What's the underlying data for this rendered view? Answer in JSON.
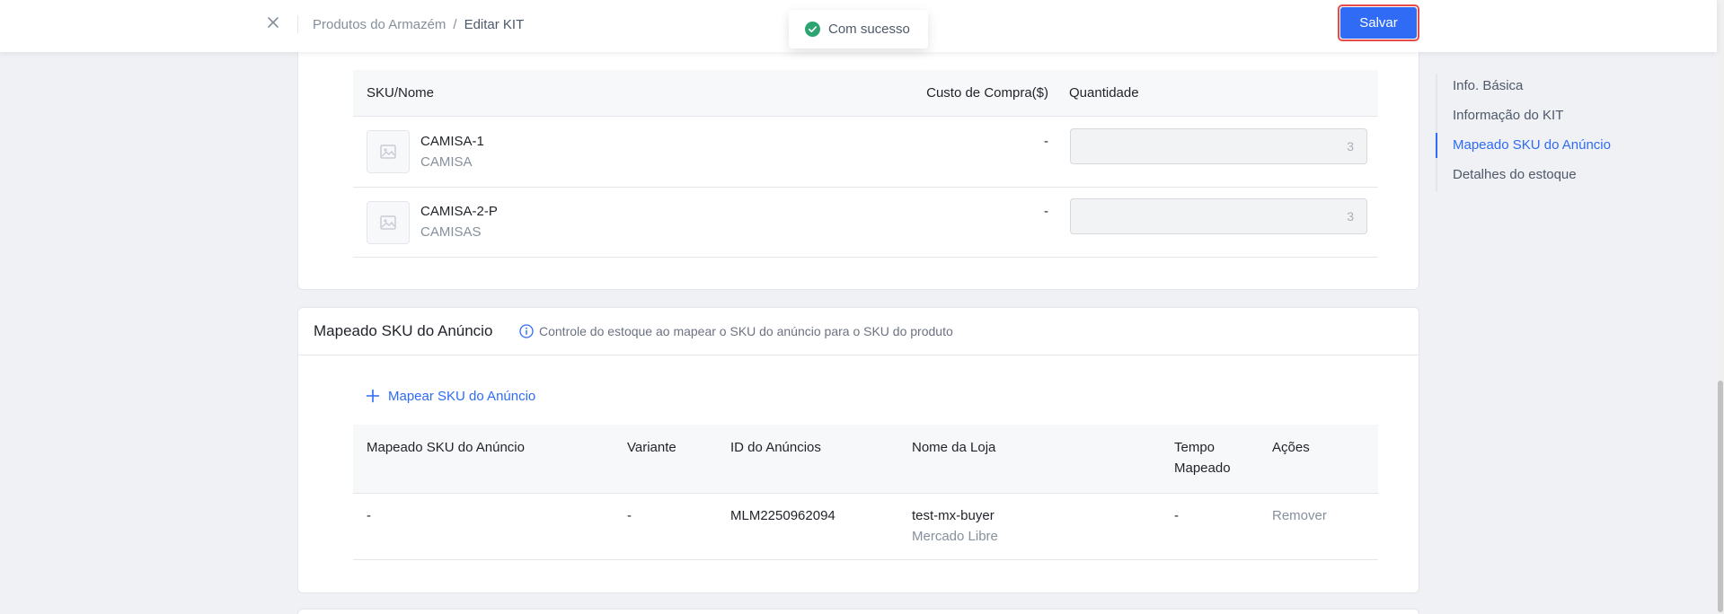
{
  "topbar": {
    "breadcrumb": {
      "parent": "Produtos do Armazém",
      "separator": "/",
      "current": "Editar KIT"
    },
    "save_label": "Salvar"
  },
  "toast": {
    "message": "Com sucesso",
    "icon": "check-circle-icon",
    "color": "#2ba471"
  },
  "kit_table": {
    "columns": {
      "sku": "SKU/Nome",
      "cost": "Custo de Compra($)",
      "qty": "Quantidade"
    },
    "rows": [
      {
        "sku": "CAMISA-1",
        "name": "CAMISA",
        "cost": "-",
        "qty": "3"
      },
      {
        "sku": "CAMISA-2-P",
        "name": "CAMISAS",
        "cost": "-",
        "qty": "3"
      }
    ]
  },
  "mapping_section": {
    "title": "Mapeado SKU do Anúncio",
    "hint": "Controle do estoque ao mapear o SKU do anúncio para o SKU do produto",
    "add_label": "Mapear SKU do Anúncio",
    "columns": {
      "sku": "Mapeado SKU do Anúncio",
      "variant": "Variante",
      "listing_id": "ID do Anúncios",
      "store": "Nome da Loja",
      "time_line1": "Tempo",
      "time_line2": "Mapeado",
      "actions": "Ações"
    },
    "rows": [
      {
        "sku": "-",
        "variant": "-",
        "listing_id": "MLM2250962094",
        "store": "test-mx-buyer",
        "platform": "Mercado Libre",
        "time": "-",
        "action": "Remover"
      }
    ]
  },
  "sidenav": {
    "items": [
      "Info. Básica",
      "Informação do KIT",
      "Mapeado SKU do Anúncio",
      "Detalhes do estoque"
    ],
    "active_index": 2
  },
  "colors": {
    "accent": "#2f6bf5",
    "save_outline": "#e84a4a",
    "success": "#2ba471"
  }
}
